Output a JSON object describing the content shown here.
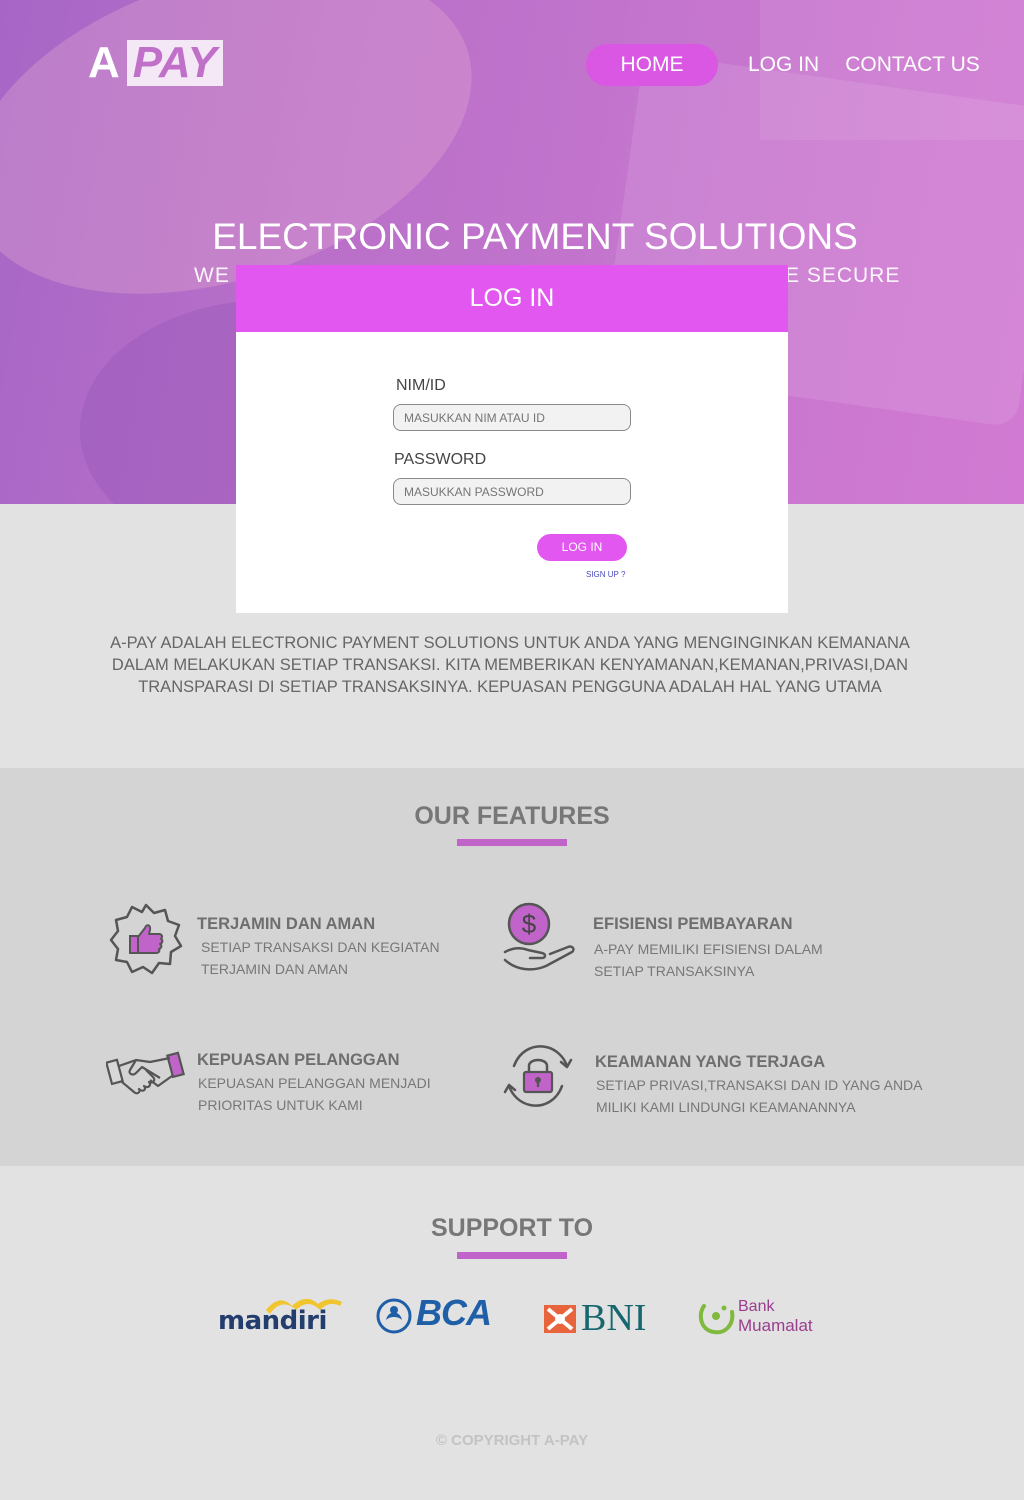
{
  "brand": {
    "logo_a": "A",
    "logo_pay": "PAY"
  },
  "nav": {
    "home": "HOME",
    "login": "LOG IN",
    "contact": "CONTACT US"
  },
  "hero": {
    "title": "ELECTRONIC PAYMENT SOLUTIONS",
    "subtitle_left": "WE I",
    "subtitle_right": "E SECURE"
  },
  "login_modal": {
    "title": "LOG IN",
    "nim_label": "NIM/ID",
    "nim_placeholder": "MASUKKAN NIM ATAU ID",
    "password_label": "PASSWORD",
    "password_placeholder": "MASUKKAN PASSWORD",
    "submit": "LOG IN",
    "signup": "SIGN UP ?"
  },
  "about": {
    "text": "A-PAY ADALAH ELECTRONIC PAYMENT SOLUTIONS UNTUK ANDA YANG MENGINGINKAN KEMANANA DALAM MELAKUKAN SETIAP TRANSAKSI. KITA MEMBERIKAN KENYAMANAN,KEMANAN,PRIVASI,DAN TRANSPARASI DI SETIAP TRANSAKSINYA. KEPUASAN PENGGUNA ADALAH HAL YANG UTAMA"
  },
  "features": {
    "title": "OUR FEATURES",
    "items": [
      {
        "icon": "thumbs-up-badge-icon",
        "title": "TERJAMIN DAN AMAN",
        "desc": "SETIAP TRANSAKSI DAN KEGIATAN TERJAMIN DAN AMAN"
      },
      {
        "icon": "money-hand-icon",
        "title": "EFISIENSI PEMBAYARAN",
        "desc": "A-PAY MEMILIKI EFISIENSI DALAM SETIAP TRANSAKSINYA"
      },
      {
        "icon": "handshake-icon",
        "title": "KEPUASAN PELANGGAN",
        "desc": "KEPUASAN PELANGGAN MENJADI PRIORITAS UNTUK KAMI"
      },
      {
        "icon": "lock-refresh-icon",
        "title": "KEAMANAN YANG TERJAGA",
        "desc": "SETIAP PRIVASI,TRANSAKSI DAN ID YANG ANDA MILIKI KAMI LINDUNGI KEAMANANNYA"
      }
    ]
  },
  "support": {
    "title": "SUPPORT TO",
    "banks": [
      {
        "name": "mandiri"
      },
      {
        "name": "BCA"
      },
      {
        "name": "BNI"
      },
      {
        "name_line1": "Bank",
        "name_line2": "Muamalat"
      }
    ]
  },
  "footer": {
    "copyright": "© COPYRIGHT A-PAY"
  },
  "colors": {
    "accent": "#e257f0",
    "underline": "#c164c9",
    "hero_tint": "#c475cd"
  }
}
